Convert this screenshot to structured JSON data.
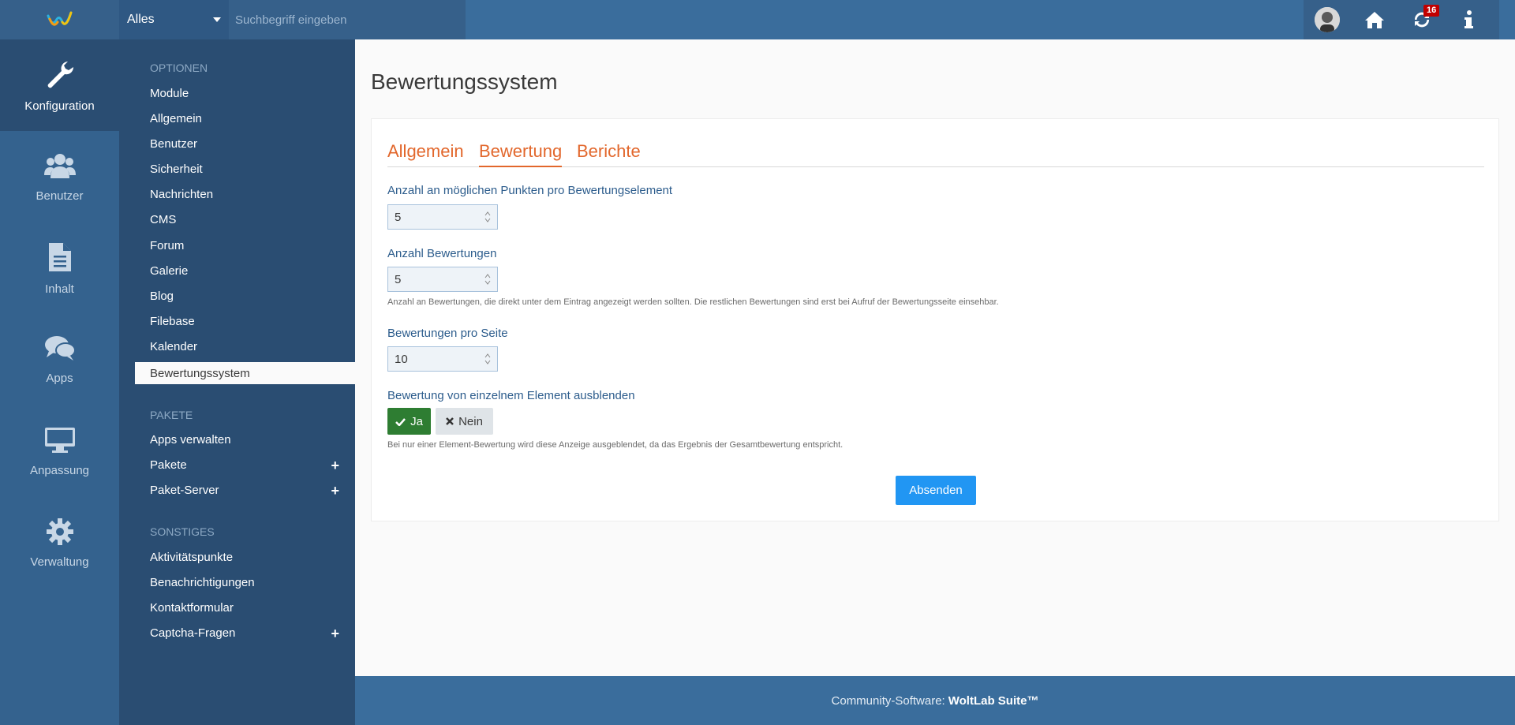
{
  "header": {
    "search_scope": "Alles",
    "search_placeholder": "Suchbegriff eingeben",
    "notification_count": "16"
  },
  "mainnav": [
    {
      "label": "Konfiguration",
      "icon": "wrench-icon",
      "active": true
    },
    {
      "label": "Benutzer",
      "icon": "users-icon"
    },
    {
      "label": "Inhalt",
      "icon": "file-text-icon"
    },
    {
      "label": "Apps",
      "icon": "comments-icon"
    },
    {
      "label": "Anpassung",
      "icon": "desktop-icon"
    },
    {
      "label": "Verwaltung",
      "icon": "gear-icon"
    }
  ],
  "subnav": {
    "sections": [
      "Optionen",
      "Pakete",
      "Sonstiges"
    ],
    "optionen": [
      "Module",
      "Allgemein",
      "Benutzer",
      "Sicherheit",
      "Nachrichten",
      "CMS",
      "Forum",
      "Galerie",
      "Blog",
      "Filebase",
      "Kalender",
      "Bewertungssystem"
    ],
    "pakete": [
      "Apps verwalten",
      "Pakete",
      "Paket-Server"
    ],
    "sonstiges": [
      "Aktivitätspunkte",
      "Benachrichtigungen",
      "Kontaktformular",
      "Captcha-Fragen"
    ]
  },
  "page": {
    "title": "Bewertungssystem",
    "tabs": [
      "Allgemein",
      "Bewertung",
      "Berichte"
    ],
    "fields": [
      {
        "label": "Anzahl an möglichen Punkten pro Bewertungselement",
        "value": "5"
      },
      {
        "label": "Anzahl Bewertungen",
        "value": "5",
        "help": "Anzahl an Bewertungen, die direkt unter dem Eintrag angezeigt werden sollten. Die restlichen Bewertungen sind erst bei Aufruf der Bewertungsseite einsehbar."
      },
      {
        "label": "Bewertungen pro Seite",
        "value": "10"
      },
      {
        "label": "Bewertung von einzelnem Element ausblenden",
        "help": "Bei nur einer Element-Bewertung wird diese Anzeige ausgeblendet, da das Ergebnis der Gesamtbewertung entspricht."
      }
    ],
    "yes_label": "Ja",
    "no_label": "Nein",
    "submit_label": "Absenden"
  },
  "footer": {
    "prefix": "Community-Software:",
    "brand": "WoltLab Suite™"
  },
  "colors": {
    "header": "#3a6d9c",
    "sidebar": "#34628e",
    "subnav": "#2a4d72",
    "tab_accent": "#e2672c",
    "submit": "#2196f3",
    "yes_active": "#2e7d32"
  }
}
